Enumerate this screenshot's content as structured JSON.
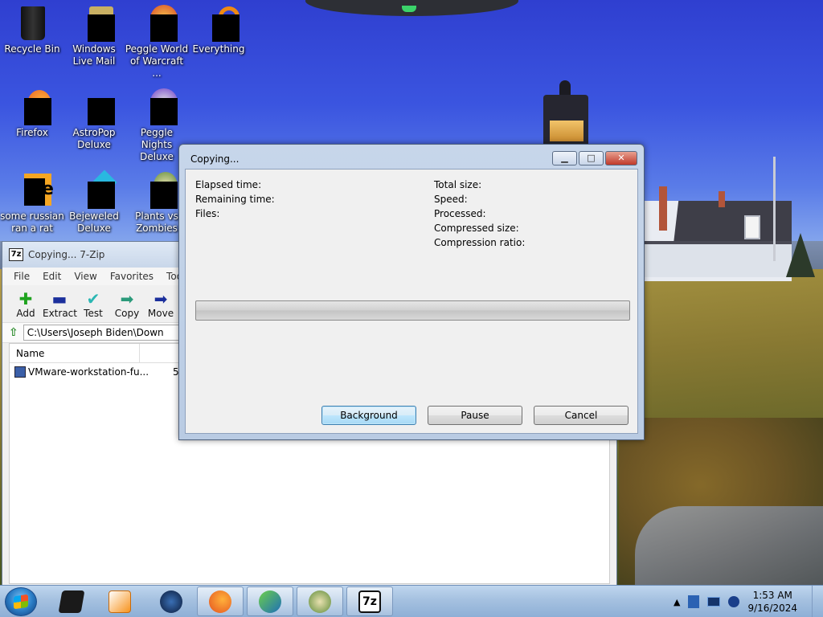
{
  "desktop_icons": [
    {
      "label": "Recycle Bin",
      "icon": "recycle-bin-icon"
    },
    {
      "label": "Windows Live Mail",
      "icon": "mail-icon"
    },
    {
      "label": "Peggle World of Warcraft ...",
      "icon": "peggle-icon"
    },
    {
      "label": "Everything",
      "icon": "search-icon"
    },
    {
      "label": "Firefox",
      "icon": "firefox-icon"
    },
    {
      "label": "AstroPop Deluxe",
      "icon": "astropop-icon"
    },
    {
      "label": "Peggle Nights Deluxe",
      "icon": "peggle-nights-icon"
    },
    {
      "label": "some russian ran a rat",
      "icon": "ie-icon"
    },
    {
      "label": "Bejeweled Deluxe",
      "icon": "bejeweled-icon"
    },
    {
      "label": "Plants vs Zombies",
      "icon": "plants-icon"
    }
  ],
  "zip_window": {
    "title": "Copying... 7-Zip",
    "app_icon": "7z",
    "menu": [
      "File",
      "Edit",
      "View",
      "Favorites",
      "Tools"
    ],
    "toolbar": [
      "Add",
      "Extract",
      "Test",
      "Copy",
      "Move"
    ],
    "address": "C:\\Users\\Joseph Biden\\Down",
    "columns": [
      "Name"
    ],
    "files": [
      {
        "name": "VMware-workstation-fu...",
        "size": "579"
      }
    ]
  },
  "dialog": {
    "title": "Copying...",
    "left_fields": [
      "Elapsed time:",
      "Remaining time:",
      "Files:"
    ],
    "right_fields": [
      "Total size:",
      "Speed:",
      "Processed:",
      "Compressed size:",
      "Compression ratio:"
    ],
    "progress": 0,
    "buttons": {
      "background": "Background",
      "pause": "Pause",
      "cancel": "Cancel"
    }
  },
  "taskbar": {
    "clock": {
      "time": "1:53 AM",
      "date": "9/16/2024"
    },
    "pinned": [
      "media-icon",
      "player-icon",
      "globe-icon",
      "firefox-icon",
      "download-manager-icon",
      "plants-icon",
      "7zip-icon"
    ],
    "tray_arrow": "▲"
  },
  "colors": {
    "taskbar": "#a5c1e0",
    "dialog_frame": "#c7d6ea",
    "close_red": "#c0392b"
  }
}
